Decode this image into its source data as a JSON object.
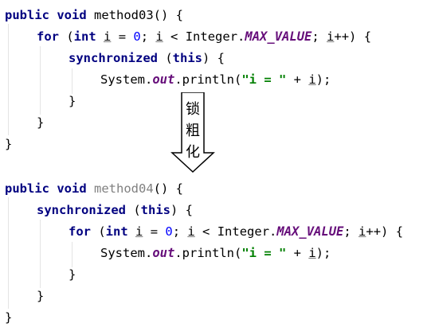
{
  "code_block_1": {
    "l1": {
      "kw1": "public",
      "kw2": "void",
      "name": "method03",
      "rest": "() {"
    },
    "l2": {
      "kw_for": "for",
      "p1": " (",
      "kw_int": "int",
      "sp1": " ",
      "v1": "i",
      "eq": " = ",
      "zero": "0",
      "semi": "; ",
      "v2": "i",
      "lt": " < Integer.",
      "max": "MAX_VALUE",
      "semi2": "; ",
      "v3": "i",
      "end": "++) {"
    },
    "l3": {
      "kw_sync": "synchronized",
      "p1": " (",
      "kw_this": "this",
      "end": ") {"
    },
    "l4": {
      "pre": "System.",
      "out": "out",
      "mid": ".println(",
      "str": "\"i = \"",
      "plus": " + ",
      "v": "i",
      "end": ");"
    },
    "l5": "}",
    "l6": "}",
    "l7": "}"
  },
  "arrow": {
    "label": "锁粗化"
  },
  "code_block_2": {
    "l1": {
      "kw1": "public",
      "kw2": "void",
      "name": "method04",
      "rest": "() {"
    },
    "l2": {
      "kw_sync": "synchronized",
      "p1": " (",
      "kw_this": "this",
      "end": ") {"
    },
    "l3": {
      "kw_for": "for",
      "p1": " (",
      "kw_int": "int",
      "sp1": " ",
      "v1": "i",
      "eq": " = ",
      "zero": "0",
      "semi": "; ",
      "v2": "i",
      "lt": " < Integer.",
      "max": "MAX_VALUE",
      "semi2": "; ",
      "v3": "i",
      "end": "++) {"
    },
    "l4": {
      "pre": "System.",
      "out": "out",
      "mid": ".println(",
      "str": "\"i = \"",
      "plus": " + ",
      "v": "i",
      "end": ");"
    },
    "l5": "}",
    "l6": "}",
    "l7": "}"
  }
}
